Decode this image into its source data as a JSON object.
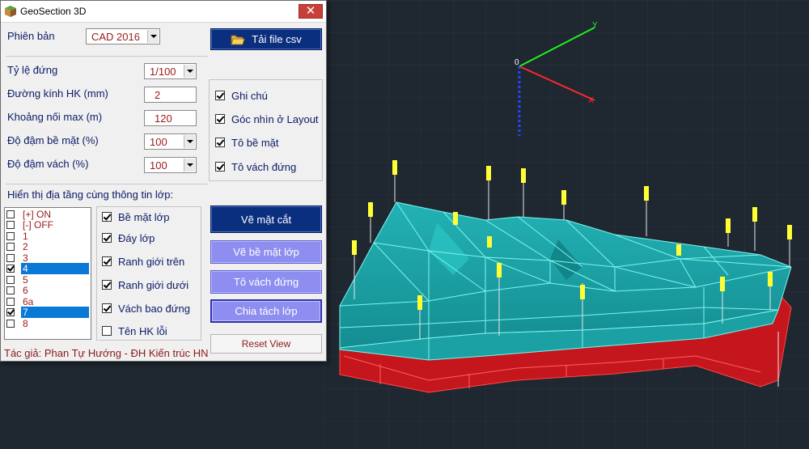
{
  "window": {
    "title": "GeoSection 3D",
    "close_label": "✕"
  },
  "version": {
    "label": "Phiên bản",
    "selected": "CAD 2016",
    "load_button_label": "Tải file csv"
  },
  "settings": {
    "vertical_scale": {
      "label": "Tỷ lệ đứng",
      "selected": "1/100"
    },
    "borehole_diameter": {
      "label": "Đường kính HK (mm)",
      "value": "2"
    },
    "max_join_distance": {
      "label": "Khoảng nối max (m)",
      "value": "120"
    },
    "surface_opacity": {
      "label": "Độ đậm bề mặt (%)",
      "selected": "100"
    },
    "wall_opacity": {
      "label": "Độ đậm vách (%)",
      "selected": "100"
    }
  },
  "options": [
    {
      "label": "Ghi chú",
      "checked": true
    },
    {
      "label": "Góc nhìn ở Layout",
      "checked": true
    },
    {
      "label": "Tô bề mặt",
      "checked": true
    },
    {
      "label": "Tô vách đứng",
      "checked": true
    }
  ],
  "layers": {
    "heading": "Hiển thị địa tầng cùng thông tin lớp:",
    "items": [
      {
        "label": "[+] ON",
        "checked": false,
        "selected": false
      },
      {
        "label": "[-] OFF",
        "checked": false,
        "selected": false
      },
      {
        "label": "1",
        "checked": false,
        "selected": false
      },
      {
        "label": "2",
        "checked": false,
        "selected": false
      },
      {
        "label": "3",
        "checked": false,
        "selected": false
      },
      {
        "label": "4",
        "checked": true,
        "selected": true
      },
      {
        "label": "5",
        "checked": false,
        "selected": false
      },
      {
        "label": "6",
        "checked": false,
        "selected": false
      },
      {
        "label": "6a",
        "checked": false,
        "selected": false
      },
      {
        "label": "7",
        "checked": true,
        "selected": true
      },
      {
        "label": "8",
        "checked": false,
        "selected": false
      }
    ]
  },
  "layer_info": [
    {
      "label": "Bề mặt lớp",
      "checked": true
    },
    {
      "label": "Đáy lớp",
      "checked": true
    },
    {
      "label": "Ranh giới trên",
      "checked": true
    },
    {
      "label": "Ranh giới dưới",
      "checked": true
    },
    {
      "label": "Vách bao đứng",
      "checked": true
    },
    {
      "label": "Tên HK lỗi",
      "checked": false
    }
  ],
  "actions": {
    "draw_section": "Vẽ mặt cắt",
    "draw_layer_surface": "Vẽ bề mặt lớp",
    "fill_walls": "Tô vách đứng",
    "split_layers": "Chia tách lớp",
    "reset_view": "Reset View"
  },
  "author": "Tác giả: Phan Tự Hướng - ĐH Kiến trúc HN",
  "colors": {
    "canvas_background": "#1f2731",
    "surface_cyan": "#1aa3a6",
    "mesh_lines": "#7df5f0",
    "lower_layer_red": "#c4161c",
    "borehole_labels": "#ffff33",
    "axis_x": "#ff2a2a",
    "axis_y": "#22ee22",
    "axis_z": "#2244ff"
  },
  "icons": {
    "app": "geosection-app-icon",
    "load": "folder-open-icon"
  }
}
